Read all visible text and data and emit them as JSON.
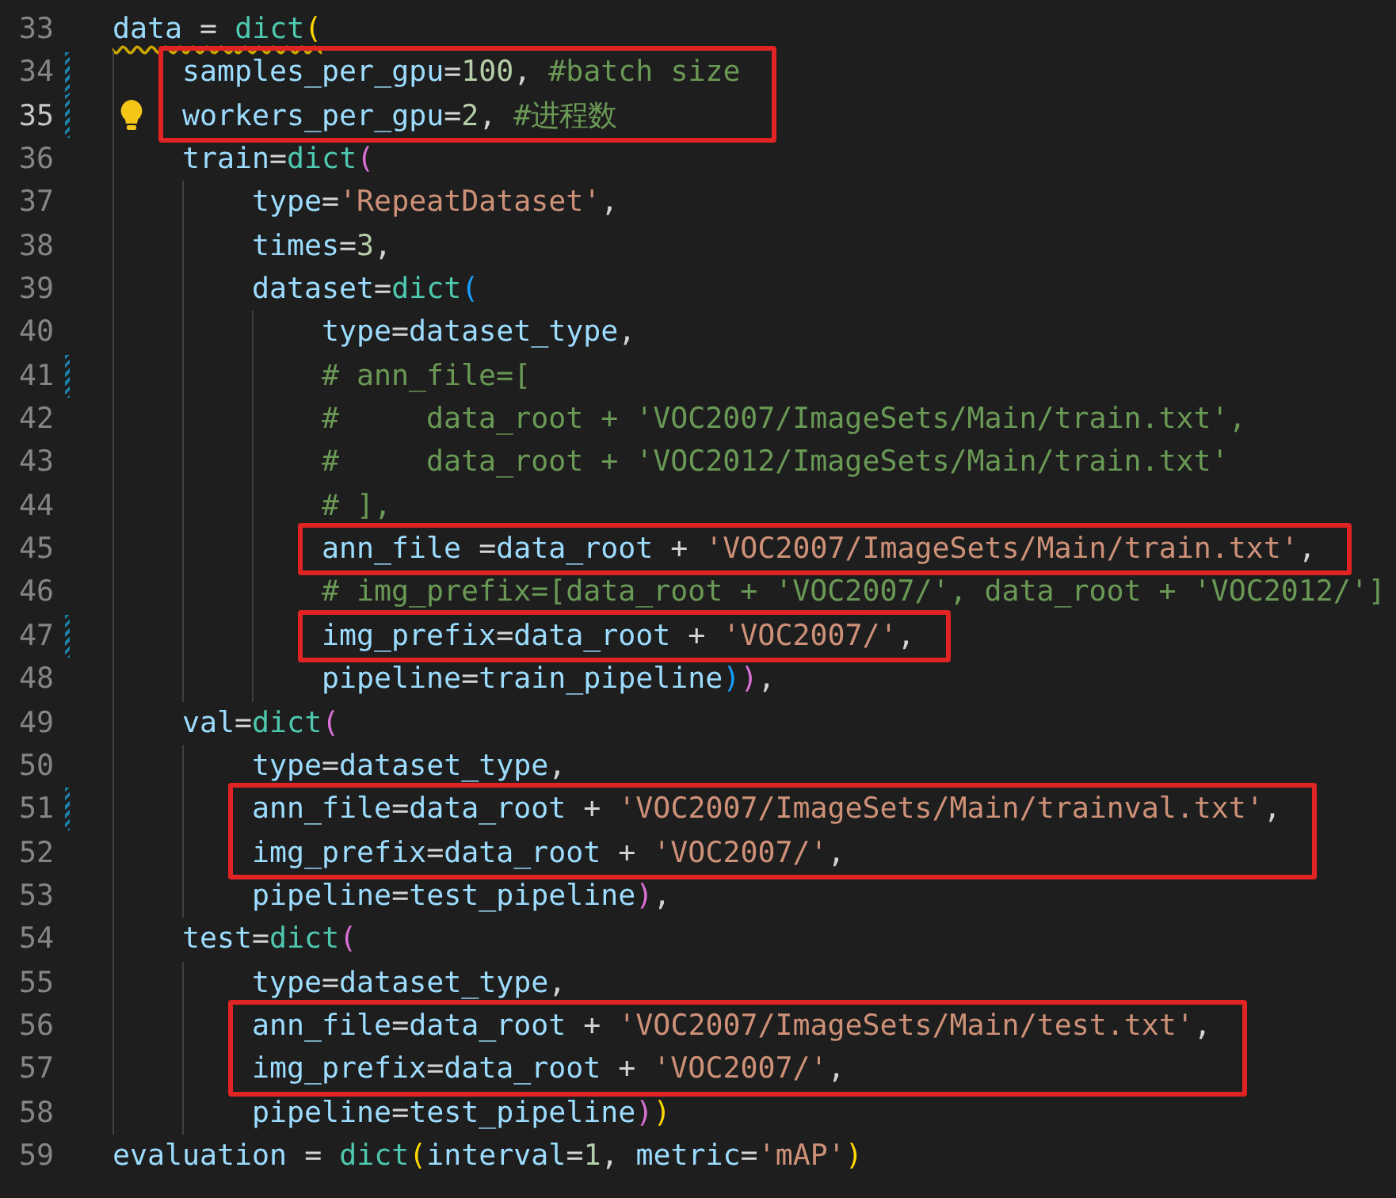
{
  "lines": [
    {
      "number": "33",
      "warning": true,
      "tokens": [
        {
          "kind": "variable",
          "text": "data"
        },
        {
          "kind": "operator",
          "text": " = "
        },
        {
          "kind": "type",
          "text": "dict"
        },
        {
          "kind": "outerbracket",
          "text": "("
        }
      ],
      "children": [
        {
          "number": "34",
          "modified": true,
          "boxed": true,
          "tokens": [
            {
              "kind": "variable",
              "text": "samples_per_gpu"
            },
            {
              "kind": "operator",
              "text": "="
            },
            {
              "kind": "number",
              "text": "100"
            },
            {
              "kind": "operator",
              "text": ", "
            },
            {
              "kind": "comment",
              "text": "#batch size"
            }
          ]
        },
        {
          "number": "35",
          "modified": true,
          "current": true,
          "lightbulb": true,
          "boxed": true,
          "tokens": [
            {
              "kind": "variable",
              "text": "workers_per_gpu"
            },
            {
              "kind": "operator",
              "text": "="
            },
            {
              "kind": "number",
              "text": "2"
            },
            {
              "kind": "operator",
              "text": ", "
            },
            {
              "kind": "comment",
              "text": "#进程数"
            }
          ]
        },
        {
          "number": "36",
          "tokens": [
            {
              "kind": "variable",
              "text": "train"
            },
            {
              "kind": "operator",
              "text": "="
            },
            {
              "kind": "type",
              "text": "dict"
            },
            {
              "kind": "middlebracket",
              "text": "("
            }
          ],
          "children": [
            {
              "number": "37",
              "tokens": [
                {
                  "kind": "variable",
                  "text": "type"
                },
                {
                  "kind": "operator",
                  "text": "="
                },
                {
                  "kind": "string",
                  "text": "'RepeatDataset'"
                },
                {
                  "kind": "operator",
                  "text": ","
                }
              ]
            },
            {
              "number": "38",
              "tokens": [
                {
                  "kind": "variable",
                  "text": "times"
                },
                {
                  "kind": "operator",
                  "text": "="
                },
                {
                  "kind": "number",
                  "text": "3"
                },
                {
                  "kind": "operator",
                  "text": ","
                }
              ]
            },
            {
              "number": "39",
              "tokens": [
                {
                  "kind": "variable",
                  "text": "dataset"
                },
                {
                  "kind": "operator",
                  "text": "="
                },
                {
                  "kind": "type",
                  "text": "dict"
                },
                {
                  "kind": "innerbracket",
                  "text": "("
                }
              ],
              "children": [
                {
                  "number": "40",
                  "tokens": [
                    {
                      "kind": "variable",
                      "text": "type"
                    },
                    {
                      "kind": "operator",
                      "text": "="
                    },
                    {
                      "kind": "variable",
                      "text": "dataset_type"
                    },
                    {
                      "kind": "operator",
                      "text": ","
                    }
                  ]
                },
                {
                  "number": "41",
                  "modified": true,
                  "tokens": [
                    {
                      "kind": "comment",
                      "text": "# ann_file=["
                    }
                  ]
                },
                {
                  "number": "42",
                  "tokens": [
                    {
                      "kind": "comment",
                      "text": "#     data_root + 'VOC2007/ImageSets/Main/train.txt',"
                    }
                  ]
                },
                {
                  "number": "43",
                  "tokens": [
                    {
                      "kind": "comment",
                      "text": "#     data_root + 'VOC2012/ImageSets/Main/train.txt'"
                    }
                  ]
                },
                {
                  "number": "44",
                  "tokens": [
                    {
                      "kind": "comment",
                      "text": "# ],"
                    }
                  ]
                },
                {
                  "number": "45",
                  "boxed": true,
                  "tokens": [
                    {
                      "kind": "variable",
                      "text": "ann_file"
                    },
                    {
                      "kind": "operator",
                      "text": " ="
                    },
                    {
                      "kind": "variable",
                      "text": "data_root"
                    },
                    {
                      "kind": "operator",
                      "text": " + "
                    },
                    {
                      "kind": "string",
                      "text": "'VOC2007/ImageSets/Main/train.txt'"
                    },
                    {
                      "kind": "operator",
                      "text": ","
                    }
                  ]
                },
                {
                  "number": "46",
                  "tokens": [
                    {
                      "kind": "comment",
                      "text": "# img_prefix=[data_root + 'VOC2007/', data_root + 'VOC2012/']"
                    }
                  ]
                },
                {
                  "number": "47",
                  "modified": true,
                  "boxed": true,
                  "tokens": [
                    {
                      "kind": "variable",
                      "text": "img_prefix"
                    },
                    {
                      "kind": "operator",
                      "text": "="
                    },
                    {
                      "kind": "variable",
                      "text": "data_root"
                    },
                    {
                      "kind": "operator",
                      "text": " + "
                    },
                    {
                      "kind": "string",
                      "text": "'VOC2007/'"
                    },
                    {
                      "kind": "operator",
                      "text": ","
                    }
                  ]
                },
                {
                  "number": "48",
                  "tokens": [
                    {
                      "kind": "variable",
                      "text": "pipeline"
                    },
                    {
                      "kind": "operator",
                      "text": "="
                    },
                    {
                      "kind": "variable",
                      "text": "train_pipeline"
                    },
                    {
                      "kind": "innerbracket",
                      "text": ")"
                    },
                    {
                      "kind": "middlebracket",
                      "text": ")"
                    },
                    {
                      "kind": "operator",
                      "text": ","
                    }
                  ]
                }
              ]
            }
          ]
        },
        {
          "number": "49",
          "tokens": [
            {
              "kind": "variable",
              "text": "val"
            },
            {
              "kind": "operator",
              "text": "="
            },
            {
              "kind": "type",
              "text": "dict"
            },
            {
              "kind": "middlebracket",
              "text": "("
            }
          ],
          "children": [
            {
              "number": "50",
              "tokens": [
                {
                  "kind": "variable",
                  "text": "type"
                },
                {
                  "kind": "operator",
                  "text": "="
                },
                {
                  "kind": "variable",
                  "text": "dataset_type"
                },
                {
                  "kind": "operator",
                  "text": ","
                }
              ]
            },
            {
              "number": "51",
              "modified": true,
              "boxed": true,
              "tokens": [
                {
                  "kind": "variable",
                  "text": "ann_file"
                },
                {
                  "kind": "operator",
                  "text": "="
                },
                {
                  "kind": "variable",
                  "text": "data_root"
                },
                {
                  "kind": "operator",
                  "text": " + "
                },
                {
                  "kind": "string",
                  "text": "'VOC2007/ImageSets/Main/trainval.txt'"
                },
                {
                  "kind": "operator",
                  "text": ","
                }
              ]
            },
            {
              "number": "52",
              "boxed": true,
              "tokens": [
                {
                  "kind": "variable",
                  "text": "img_prefix"
                },
                {
                  "kind": "operator",
                  "text": "="
                },
                {
                  "kind": "variable",
                  "text": "data_root"
                },
                {
                  "kind": "operator",
                  "text": " + "
                },
                {
                  "kind": "string",
                  "text": "'VOC2007/'"
                },
                {
                  "kind": "operator",
                  "text": ","
                }
              ]
            },
            {
              "number": "53",
              "tokens": [
                {
                  "kind": "variable",
                  "text": "pipeline"
                },
                {
                  "kind": "operator",
                  "text": "="
                },
                {
                  "kind": "variable",
                  "text": "test_pipeline"
                },
                {
                  "kind": "middlebracket",
                  "text": ")"
                },
                {
                  "kind": "operator",
                  "text": ","
                }
              ]
            }
          ]
        },
        {
          "number": "54",
          "tokens": [
            {
              "kind": "variable",
              "text": "test"
            },
            {
              "kind": "operator",
              "text": "="
            },
            {
              "kind": "type",
              "text": "dict"
            },
            {
              "kind": "middlebracket",
              "text": "("
            }
          ],
          "children": [
            {
              "number": "55",
              "tokens": [
                {
                  "kind": "variable",
                  "text": "type"
                },
                {
                  "kind": "operator",
                  "text": "="
                },
                {
                  "kind": "variable",
                  "text": "dataset_type"
                },
                {
                  "kind": "operator",
                  "text": ","
                }
              ]
            },
            {
              "number": "56",
              "boxed": true,
              "tokens": [
                {
                  "kind": "variable",
                  "text": "ann_file"
                },
                {
                  "kind": "operator",
                  "text": "="
                },
                {
                  "kind": "variable",
                  "text": "data_root"
                },
                {
                  "kind": "operator",
                  "text": " + "
                },
                {
                  "kind": "string",
                  "text": "'VOC2007/ImageSets/Main/test.txt'"
                },
                {
                  "kind": "operator",
                  "text": ","
                }
              ]
            },
            {
              "number": "57",
              "boxed": true,
              "tokens": [
                {
                  "kind": "variable",
                  "text": "img_prefix"
                },
                {
                  "kind": "operator",
                  "text": "="
                },
                {
                  "kind": "variable",
                  "text": "data_root"
                },
                {
                  "kind": "operator",
                  "text": " + "
                },
                {
                  "kind": "string",
                  "text": "'VOC2007/'"
                },
                {
                  "kind": "operator",
                  "text": ","
                }
              ]
            },
            {
              "number": "58",
              "tokens": [
                {
                  "kind": "variable",
                  "text": "pipeline"
                },
                {
                  "kind": "operator",
                  "text": "="
                },
                {
                  "kind": "variable",
                  "text": "test_pipeline"
                },
                {
                  "kind": "middlebracket",
                  "text": ")"
                },
                {
                  "kind": "outerbracket",
                  "text": ")"
                }
              ]
            }
          ]
        }
      ]
    },
    {
      "number": "59",
      "tokens": [
        {
          "kind": "variable",
          "text": "evaluation"
        },
        {
          "kind": "operator",
          "text": " = "
        },
        {
          "kind": "type",
          "text": "dict"
        },
        {
          "kind": "outerbracket",
          "text": "("
        },
        {
          "kind": "variable",
          "text": "interval"
        },
        {
          "kind": "operator",
          "text": "="
        },
        {
          "kind": "number",
          "text": "1"
        },
        {
          "kind": "operator",
          "text": ", "
        },
        {
          "kind": "variable",
          "text": "metric"
        },
        {
          "kind": "operator",
          "text": "="
        },
        {
          "kind": "string",
          "text": "'mAP'"
        },
        {
          "kind": "outerbracket",
          "text": ")"
        }
      ]
    }
  ]
}
